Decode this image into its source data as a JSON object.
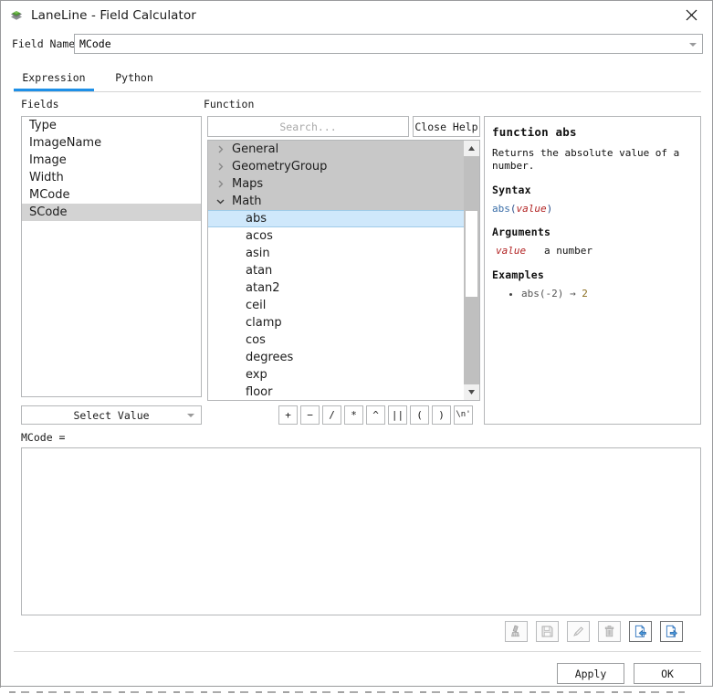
{
  "window": {
    "title": "LaneLine - Field Calculator",
    "app_icon": "layers-icon",
    "close_label": "✕"
  },
  "field_name": {
    "label": "Field Name",
    "value": "MCode"
  },
  "tabs": [
    {
      "label": "Expression",
      "active": true
    },
    {
      "label": "Python",
      "active": false
    }
  ],
  "fields_panel": {
    "heading": "Fields",
    "items": [
      {
        "label": "Type",
        "selected": false
      },
      {
        "label": "ImageName",
        "selected": false
      },
      {
        "label": "Image",
        "selected": false
      },
      {
        "label": "Width",
        "selected": false
      },
      {
        "label": "MCode",
        "selected": false
      },
      {
        "label": "SCode",
        "selected": true
      }
    ],
    "select_value_button": "Select Value"
  },
  "function_panel": {
    "heading": "Function",
    "search_placeholder": "Search...",
    "search_value": "",
    "close_help_button": "Close Help",
    "tree": [
      {
        "label": "General",
        "type": "group",
        "expanded": false
      },
      {
        "label": "GeometryGroup",
        "type": "group",
        "expanded": false
      },
      {
        "label": "Maps",
        "type": "group",
        "expanded": false
      },
      {
        "label": "Math",
        "type": "group",
        "expanded": true
      },
      {
        "label": "abs",
        "type": "leaf",
        "selected": true
      },
      {
        "label": "acos",
        "type": "leaf",
        "selected": false
      },
      {
        "label": "asin",
        "type": "leaf",
        "selected": false
      },
      {
        "label": "atan",
        "type": "leaf",
        "selected": false
      },
      {
        "label": "atan2",
        "type": "leaf",
        "selected": false
      },
      {
        "label": "ceil",
        "type": "leaf",
        "selected": false
      },
      {
        "label": "clamp",
        "type": "leaf",
        "selected": false
      },
      {
        "label": "cos",
        "type": "leaf",
        "selected": false
      },
      {
        "label": "degrees",
        "type": "leaf",
        "selected": false
      },
      {
        "label": "exp",
        "type": "leaf",
        "selected": false
      },
      {
        "label": "floor",
        "type": "leaf",
        "selected": false
      }
    ],
    "operators": [
      "+",
      "−",
      "/",
      "*",
      "^",
      "||",
      "(",
      ")",
      "\\n'"
    ]
  },
  "help_panel": {
    "title": "function abs",
    "description": "Returns the absolute value of a number.",
    "syntax_heading": "Syntax",
    "syntax": {
      "fn": "abs",
      "open": "(",
      "arg": "value",
      "close": ")"
    },
    "arguments_heading": "Arguments",
    "arguments": [
      {
        "name": "value",
        "desc": "a number"
      }
    ],
    "examples_heading": "Examples",
    "examples": [
      {
        "code": "abs(-2)",
        "arrow": "→",
        "result": "2"
      }
    ]
  },
  "expression": {
    "label": "MCode =",
    "value": "",
    "placeholder": ""
  },
  "toolbar_icons": [
    {
      "name": "clear-brush-icon",
      "enabled": false
    },
    {
      "name": "save-icon",
      "enabled": false
    },
    {
      "name": "edit-pencil-icon",
      "enabled": false
    },
    {
      "name": "delete-trash-icon",
      "enabled": false
    },
    {
      "name": "import-icon",
      "enabled": true
    },
    {
      "name": "export-icon",
      "enabled": true
    }
  ],
  "footer": {
    "apply_label": "Apply",
    "ok_label": "OK"
  },
  "colors": {
    "accent": "#1e90e8",
    "selection_blue": "#cfe8fb",
    "group_row_gray": "#c8c8c8",
    "field_selected_gray": "#d3d3d3",
    "syntax_fn": "#3a6ea8",
    "syntax_arg": "#b22222",
    "border": "#b4b6b8"
  }
}
